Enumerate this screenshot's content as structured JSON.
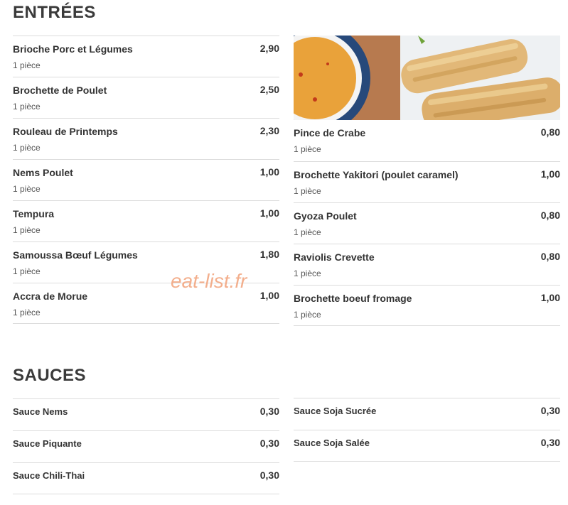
{
  "entrees": {
    "title": "ENTRÉES",
    "left": [
      {
        "name": "Brioche Porc et Légumes",
        "price": "2,90",
        "desc": "1 pièce"
      },
      {
        "name": "Brochette de Poulet",
        "price": "2,50",
        "desc": "1 pièce"
      },
      {
        "name": "Rouleau de Printemps",
        "price": "2,30",
        "desc": "1 pièce"
      },
      {
        "name": "Nems Poulet",
        "price": "1,00",
        "desc": "1 pièce"
      },
      {
        "name": "Tempura",
        "price": "1,00",
        "desc": "1 pièce"
      },
      {
        "name": "Samoussa Bœuf Légumes",
        "price": "1,80",
        "desc": "1 pièce"
      },
      {
        "name": "Accra de Morue",
        "price": "1,00",
        "desc": "1 pièce"
      }
    ],
    "right": [
      {
        "name": "Pince de Crabe",
        "price": "0,80",
        "desc": "1 pièce"
      },
      {
        "name": "Brochette Yakitori (poulet caramel)",
        "price": "1,00",
        "desc": "1 pièce"
      },
      {
        "name": "Gyoza Poulet",
        "price": "0,80",
        "desc": "1 pièce"
      },
      {
        "name": "Raviolis Crevette",
        "price": "0,80",
        "desc": "1 pièce"
      },
      {
        "name": "Brochette boeuf fromage",
        "price": "1,00",
        "desc": "1 pièce"
      }
    ]
  },
  "sauces": {
    "title": "SAUCES",
    "left": [
      {
        "name": "Sauce Nems",
        "price": "0,30"
      },
      {
        "name": "Sauce Piquante",
        "price": "0,30"
      },
      {
        "name": "Sauce Chili-Thai",
        "price": "0,30"
      }
    ],
    "right": [
      {
        "name": "Sauce Soja Sucrée",
        "price": "0,30"
      },
      {
        "name": "Sauce Soja Salée",
        "price": "0,30"
      }
    ]
  },
  "watermark": "eat-list.fr",
  "colors": {
    "watermark": "#f2a27a",
    "divider": "#dcdcdc",
    "text": "#333333"
  }
}
